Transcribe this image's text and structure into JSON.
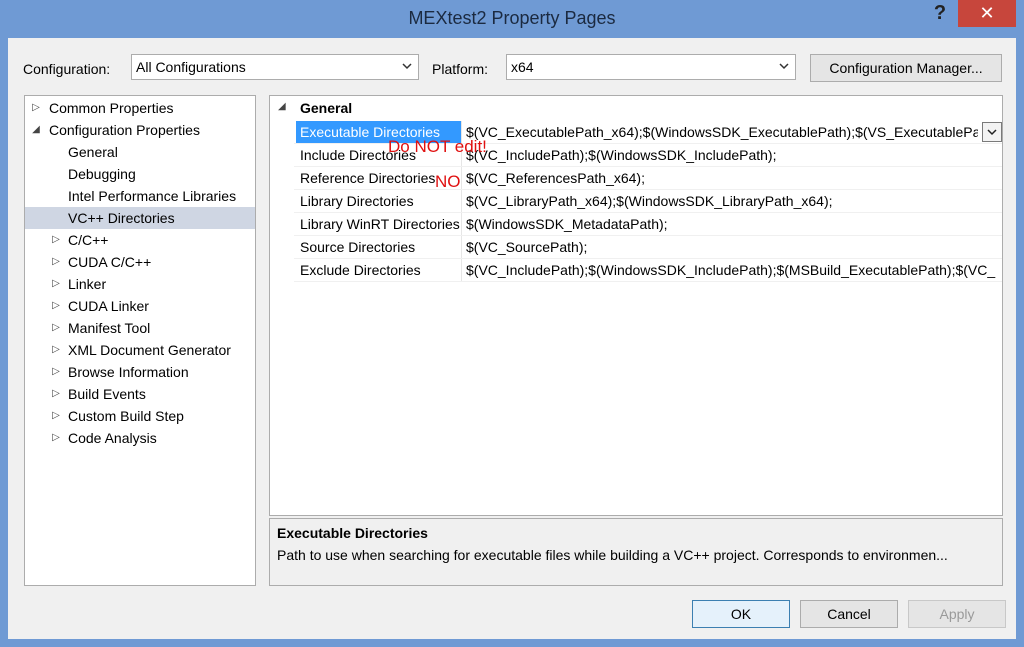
{
  "window": {
    "title": "MEXtest2 Property Pages",
    "help_glyph": "?",
    "close_glyph": "✕"
  },
  "toolbar": {
    "configuration_label": "Configuration:",
    "configuration_value": "All Configurations",
    "platform_label": "Platform:",
    "platform_value": "x64",
    "config_manager_label": "Configuration Manager..."
  },
  "tree": {
    "items": [
      {
        "label": "Common Properties",
        "expander": "▷"
      },
      {
        "label": "Configuration Properties",
        "expander": "◢"
      },
      {
        "label": "General"
      },
      {
        "label": "Debugging"
      },
      {
        "label": "Intel Performance Libraries"
      },
      {
        "label": "VC++ Directories",
        "selected": true
      },
      {
        "label": "C/C++",
        "expander": "▷"
      },
      {
        "label": "CUDA C/C++",
        "expander": "▷"
      },
      {
        "label": "Linker",
        "expander": "▷"
      },
      {
        "label": "CUDA Linker",
        "expander": "▷"
      },
      {
        "label": "Manifest Tool",
        "expander": "▷"
      },
      {
        "label": "XML Document Generator",
        "expander": "▷"
      },
      {
        "label": "Browse Information",
        "expander": "▷"
      },
      {
        "label": "Build Events",
        "expander": "▷"
      },
      {
        "label": "Custom Build Step",
        "expander": "▷"
      },
      {
        "label": "Code Analysis",
        "expander": "▷"
      }
    ]
  },
  "grid": {
    "category": "General",
    "rows": [
      {
        "name": "Executable Directories",
        "value": "$(VC_ExecutablePath_x64);$(WindowsSDK_ExecutablePath);$(VS_ExecutablePa"
      },
      {
        "name": "Include Directories",
        "value": "$(VC_IncludePath);$(WindowsSDK_IncludePath);"
      },
      {
        "name": "Reference Directories",
        "value": "$(VC_ReferencesPath_x64);"
      },
      {
        "name": "Library Directories",
        "value": "$(VC_LibraryPath_x64);$(WindowsSDK_LibraryPath_x64);"
      },
      {
        "name": "Library WinRT Directories",
        "value": "$(WindowsSDK_MetadataPath);"
      },
      {
        "name": "Source Directories",
        "value": "$(VC_SourcePath);"
      },
      {
        "name": "Exclude Directories",
        "value": "$(VC_IncludePath);$(WindowsSDK_IncludePath);$(MSBuild_ExecutablePath);$(VC_"
      }
    ],
    "annotations": {
      "do_not_edit": "Do NOT edit!",
      "no": "NO"
    }
  },
  "description": {
    "title": "Executable Directories",
    "text": "Path to use when searching for executable files while building a VC++ project.  Corresponds to environmen..."
  },
  "buttons": {
    "ok": "OK",
    "cancel": "Cancel",
    "apply": "Apply"
  }
}
